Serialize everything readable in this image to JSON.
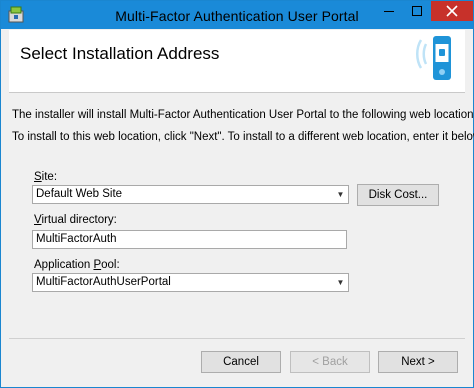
{
  "window": {
    "title": "Multi-Factor Authentication User Portal"
  },
  "header": {
    "title": "Select Installation Address"
  },
  "content": {
    "intro": "The installer will install Multi-Factor Authentication User Portal to the following web location.",
    "instructions": "To install to this web location, click \"Next\". To install to a different web location, enter it below.",
    "site": {
      "label_accel": "S",
      "label_rest": "ite:",
      "value": "Default Web Site"
    },
    "disk_cost_label": "Disk Cost...",
    "virtual_directory": {
      "label_accel": "V",
      "label_rest": "irtual directory:",
      "value": "MultiFactorAuth"
    },
    "app_pool": {
      "label_pre": "Application ",
      "label_accel": "P",
      "label_rest": "ool:",
      "value": "MultiFactorAuthUserPortal"
    }
  },
  "footer": {
    "cancel_label": "Cancel",
    "back_label": "< Back",
    "next_label": "Next >"
  },
  "colors": {
    "titlebar": "#1a8ad8",
    "close": "#c7312a",
    "logo": "#1f94d8"
  },
  "icons": [
    "installer-app-icon",
    "minimize-icon",
    "maximize-icon",
    "close-icon",
    "phone-logo-icon",
    "dropdown-arrow-icon"
  ]
}
